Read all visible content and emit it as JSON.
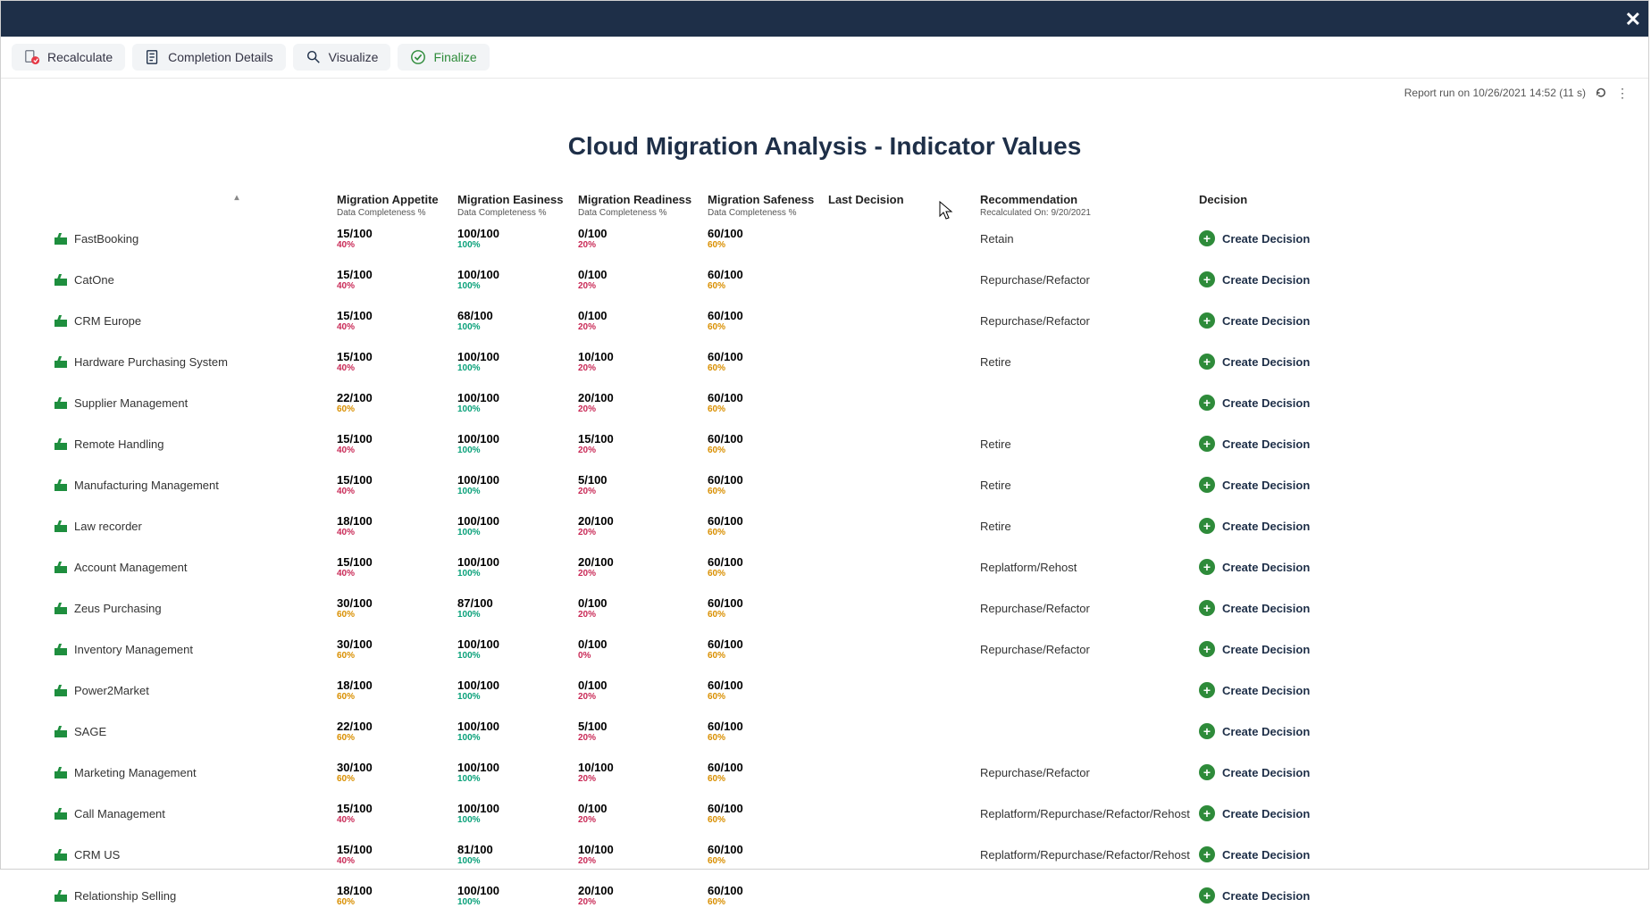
{
  "toolbar": {
    "recalculate": "Recalculate",
    "completion_details": "Completion Details",
    "visualize": "Visualize",
    "finalize": "Finalize"
  },
  "meta": {
    "report_run": "Report run on 10/26/2021 14:52 (11 s)"
  },
  "title": "Cloud Migration Analysis - Indicator Values",
  "columns": {
    "appetite": {
      "label": "Migration Appetite",
      "sub": "Data Completeness %"
    },
    "easiness": {
      "label": "Migration Easiness",
      "sub": "Data Completeness %"
    },
    "readiness": {
      "label": "Migration Readiness",
      "sub": "Data Completeness %"
    },
    "safeness": {
      "label": "Migration Safeness",
      "sub": "Data Completeness %"
    },
    "last_decision": {
      "label": "Last Decision"
    },
    "recommendation": {
      "label": "Recommendation",
      "sub": "Recalculated On: 9/20/2021"
    },
    "decision": {
      "label": "Decision"
    }
  },
  "decision_button_label": "Create Decision",
  "rows": [
    {
      "name": "FastBooking",
      "appetite": {
        "v": "15/100",
        "p": "40%",
        "cls": "c-red"
      },
      "easiness": {
        "v": "100/100",
        "p": "100%",
        "cls": "c-green"
      },
      "readiness": {
        "v": "0/100",
        "p": "20%",
        "cls": "c-red"
      },
      "safeness": {
        "v": "60/100",
        "p": "60%",
        "cls": "c-amber"
      },
      "recommendation": "Retain"
    },
    {
      "name": "CatOne",
      "appetite": {
        "v": "15/100",
        "p": "40%",
        "cls": "c-red"
      },
      "easiness": {
        "v": "100/100",
        "p": "100%",
        "cls": "c-green"
      },
      "readiness": {
        "v": "0/100",
        "p": "20%",
        "cls": "c-red"
      },
      "safeness": {
        "v": "60/100",
        "p": "60%",
        "cls": "c-amber"
      },
      "recommendation": "Repurchase/Refactor"
    },
    {
      "name": "CRM Europe",
      "appetite": {
        "v": "15/100",
        "p": "40%",
        "cls": "c-red"
      },
      "easiness": {
        "v": "68/100",
        "p": "100%",
        "cls": "c-green"
      },
      "readiness": {
        "v": "0/100",
        "p": "20%",
        "cls": "c-red"
      },
      "safeness": {
        "v": "60/100",
        "p": "60%",
        "cls": "c-amber"
      },
      "recommendation": "Repurchase/Refactor"
    },
    {
      "name": "Hardware Purchasing System",
      "appetite": {
        "v": "15/100",
        "p": "40%",
        "cls": "c-red"
      },
      "easiness": {
        "v": "100/100",
        "p": "100%",
        "cls": "c-green"
      },
      "readiness": {
        "v": "10/100",
        "p": "20%",
        "cls": "c-red"
      },
      "safeness": {
        "v": "60/100",
        "p": "60%",
        "cls": "c-amber"
      },
      "recommendation": "Retire"
    },
    {
      "name": "Supplier Management",
      "appetite": {
        "v": "22/100",
        "p": "60%",
        "cls": "c-amber"
      },
      "easiness": {
        "v": "100/100",
        "p": "100%",
        "cls": "c-green"
      },
      "readiness": {
        "v": "20/100",
        "p": "20%",
        "cls": "c-red"
      },
      "safeness": {
        "v": "60/100",
        "p": "60%",
        "cls": "c-amber"
      },
      "recommendation": ""
    },
    {
      "name": "Remote Handling",
      "appetite": {
        "v": "15/100",
        "p": "40%",
        "cls": "c-red"
      },
      "easiness": {
        "v": "100/100",
        "p": "100%",
        "cls": "c-green"
      },
      "readiness": {
        "v": "15/100",
        "p": "20%",
        "cls": "c-red"
      },
      "safeness": {
        "v": "60/100",
        "p": "60%",
        "cls": "c-amber"
      },
      "recommendation": "Retire"
    },
    {
      "name": "Manufacturing Management",
      "appetite": {
        "v": "15/100",
        "p": "40%",
        "cls": "c-red"
      },
      "easiness": {
        "v": "100/100",
        "p": "100%",
        "cls": "c-green"
      },
      "readiness": {
        "v": "5/100",
        "p": "20%",
        "cls": "c-red"
      },
      "safeness": {
        "v": "60/100",
        "p": "60%",
        "cls": "c-amber"
      },
      "recommendation": "Retire"
    },
    {
      "name": "Law recorder",
      "appetite": {
        "v": "18/100",
        "p": "40%",
        "cls": "c-red"
      },
      "easiness": {
        "v": "100/100",
        "p": "100%",
        "cls": "c-green"
      },
      "readiness": {
        "v": "20/100",
        "p": "20%",
        "cls": "c-red"
      },
      "safeness": {
        "v": "60/100",
        "p": "60%",
        "cls": "c-amber"
      },
      "recommendation": "Retire"
    },
    {
      "name": "Account Management",
      "appetite": {
        "v": "15/100",
        "p": "40%",
        "cls": "c-red"
      },
      "easiness": {
        "v": "100/100",
        "p": "100%",
        "cls": "c-green"
      },
      "readiness": {
        "v": "20/100",
        "p": "20%",
        "cls": "c-red"
      },
      "safeness": {
        "v": "60/100",
        "p": "60%",
        "cls": "c-amber"
      },
      "recommendation": "Replatform/Rehost"
    },
    {
      "name": "Zeus Purchasing",
      "appetite": {
        "v": "30/100",
        "p": "60%",
        "cls": "c-amber"
      },
      "easiness": {
        "v": "87/100",
        "p": "100%",
        "cls": "c-green"
      },
      "readiness": {
        "v": "0/100",
        "p": "20%",
        "cls": "c-red"
      },
      "safeness": {
        "v": "60/100",
        "p": "60%",
        "cls": "c-amber"
      },
      "recommendation": "Repurchase/Refactor"
    },
    {
      "name": "Inventory Management",
      "appetite": {
        "v": "30/100",
        "p": "60%",
        "cls": "c-amber"
      },
      "easiness": {
        "v": "100/100",
        "p": "100%",
        "cls": "c-green"
      },
      "readiness": {
        "v": "0/100",
        "p": "0%",
        "cls": "c-red"
      },
      "safeness": {
        "v": "60/100",
        "p": "60%",
        "cls": "c-amber"
      },
      "recommendation": "Repurchase/Refactor"
    },
    {
      "name": "Power2Market",
      "appetite": {
        "v": "18/100",
        "p": "60%",
        "cls": "c-amber"
      },
      "easiness": {
        "v": "100/100",
        "p": "100%",
        "cls": "c-green"
      },
      "readiness": {
        "v": "0/100",
        "p": "20%",
        "cls": "c-red"
      },
      "safeness": {
        "v": "60/100",
        "p": "60%",
        "cls": "c-amber"
      },
      "recommendation": ""
    },
    {
      "name": "SAGE",
      "appetite": {
        "v": "22/100",
        "p": "60%",
        "cls": "c-amber"
      },
      "easiness": {
        "v": "100/100",
        "p": "100%",
        "cls": "c-green"
      },
      "readiness": {
        "v": "5/100",
        "p": "20%",
        "cls": "c-red"
      },
      "safeness": {
        "v": "60/100",
        "p": "60%",
        "cls": "c-amber"
      },
      "recommendation": ""
    },
    {
      "name": "Marketing Management",
      "appetite": {
        "v": "30/100",
        "p": "60%",
        "cls": "c-amber"
      },
      "easiness": {
        "v": "100/100",
        "p": "100%",
        "cls": "c-green"
      },
      "readiness": {
        "v": "10/100",
        "p": "20%",
        "cls": "c-red"
      },
      "safeness": {
        "v": "60/100",
        "p": "60%",
        "cls": "c-amber"
      },
      "recommendation": "Repurchase/Refactor"
    },
    {
      "name": "Call Management",
      "appetite": {
        "v": "15/100",
        "p": "40%",
        "cls": "c-red"
      },
      "easiness": {
        "v": "100/100",
        "p": "100%",
        "cls": "c-green"
      },
      "readiness": {
        "v": "0/100",
        "p": "20%",
        "cls": "c-red"
      },
      "safeness": {
        "v": "60/100",
        "p": "60%",
        "cls": "c-amber"
      },
      "recommendation": "Replatform/Repurchase/Refactor/Rehost"
    },
    {
      "name": "CRM US",
      "appetite": {
        "v": "15/100",
        "p": "40%",
        "cls": "c-red"
      },
      "easiness": {
        "v": "81/100",
        "p": "100%",
        "cls": "c-green"
      },
      "readiness": {
        "v": "10/100",
        "p": "20%",
        "cls": "c-red"
      },
      "safeness": {
        "v": "60/100",
        "p": "60%",
        "cls": "c-amber"
      },
      "recommendation": "Replatform/Repurchase/Refactor/Rehost"
    },
    {
      "name": "Relationship Selling",
      "appetite": {
        "v": "18/100",
        "p": "60%",
        "cls": "c-amber"
      },
      "easiness": {
        "v": "100/100",
        "p": "100%",
        "cls": "c-green"
      },
      "readiness": {
        "v": "20/100",
        "p": "20%",
        "cls": "c-red"
      },
      "safeness": {
        "v": "60/100",
        "p": "60%",
        "cls": "c-amber"
      },
      "recommendation": ""
    }
  ]
}
